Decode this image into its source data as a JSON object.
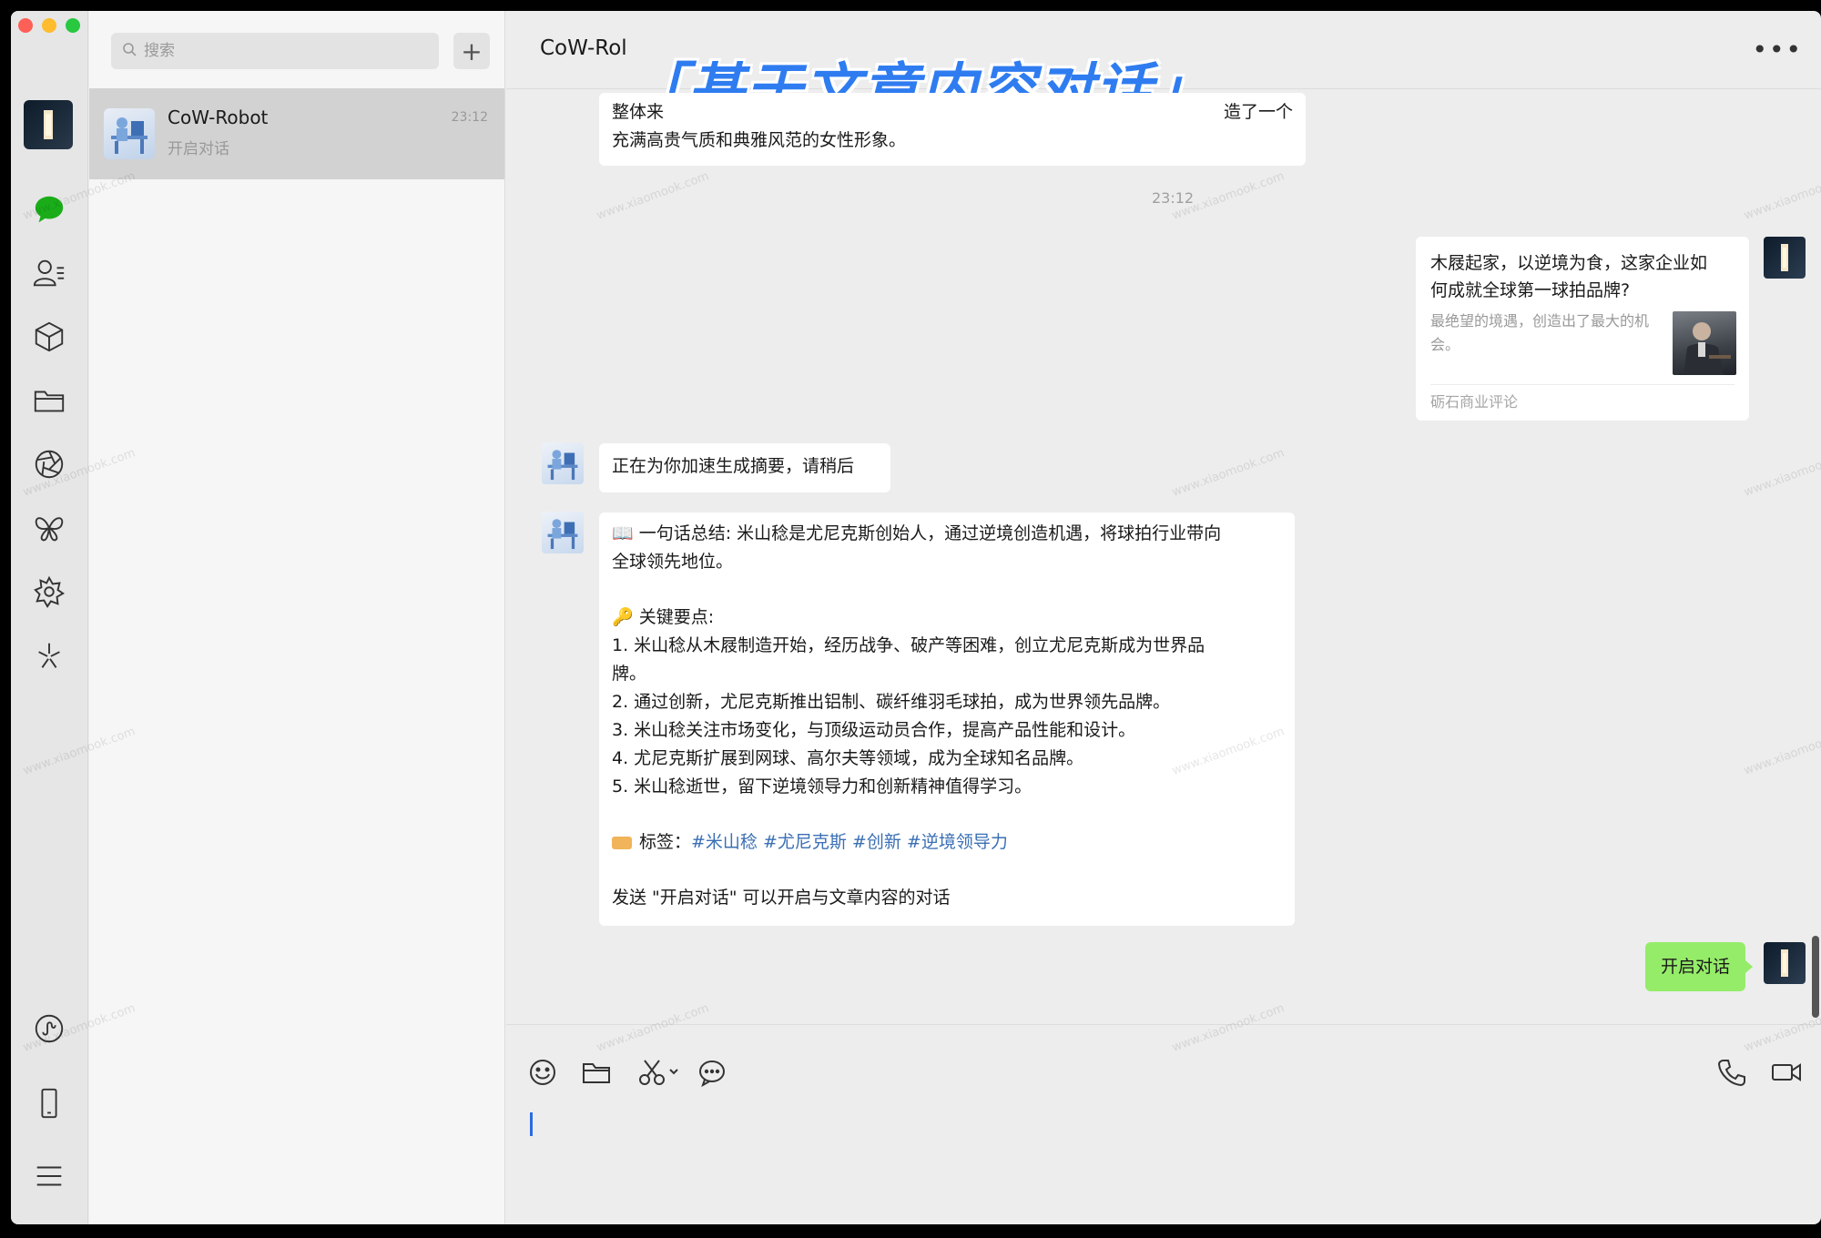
{
  "window": {
    "traffic_lights": {
      "close": "#fe5f57",
      "minimize": "#febc2e",
      "maximize": "#28c840"
    }
  },
  "sidebar": {
    "icons": [
      "user-avatar",
      "chat-icon",
      "contacts-icon",
      "box-icon",
      "folder-icon",
      "aperture-icon",
      "butterfly-icon",
      "gear-flower-icon",
      "sparkle-icon",
      "mini-program-icon",
      "phone-icon",
      "menu-icon"
    ]
  },
  "chat_list": {
    "search_placeholder": "搜索",
    "add_label": "+",
    "items": [
      {
        "name": "CoW-Robot",
        "time": "23:12",
        "preview": "开启对话"
      }
    ]
  },
  "chat": {
    "title": "CoW-Rol",
    "overlay_title": "「基于文章内容对话」",
    "more_label": "•••",
    "messages": {
      "top_partial_line1": "整体来",
      "top_partial_line1_end": "造了一个",
      "top_partial_line2": "充满高贵气质和典雅风范的女性形象。",
      "timestamp": "23:12",
      "card": {
        "title": "木屐起家，以逆境为食，这家企业如何成就全球第一球拍品牌?",
        "desc": "最绝望的境遇，创造出了最大的机会。",
        "source": "砺石商业评论"
      },
      "generating": "正在为你加速生成摘要，请稍后",
      "summary": {
        "line1": "📖 一句话总结: 米山稔是尤尼克斯创始人，通过逆境创造机遇，将球拍行业带向",
        "line2": "全球领先地位。",
        "keypoints_header": "🔑 关键要点:",
        "kp1a": "1. 米山稔从木屐制造开始，经历战争、破产等困难，创立尤尼克斯成为世界品",
        "kp1b": "牌。",
        "kp2": "2. 通过创新，尤尼克斯推出铝制、碳纤维羽毛球拍，成为世界领先品牌。",
        "kp3": "3. 米山稔关注市场变化，与顶级运动员合作，提高产品性能和设计。",
        "kp4": "4. 尤尼克斯扩展到网球、高尔夫等领域，成为全球知名品牌。",
        "kp5": "5. 米山稔逝世，留下逆境领导力和创新精神值得学习。",
        "tags_label": "标签：",
        "tags": "#米山稔 #尤尼克斯 #创新 #逆境领导力",
        "footer": "发送 \"开启对话\" 可以开启与文章内容的对话"
      },
      "sent": "开启对话"
    }
  },
  "composer": {
    "tools": [
      "emoji-icon",
      "folder-icon",
      "scissors-icon",
      "chat-bubble-icon"
    ],
    "right_tools": [
      "phone-call-icon",
      "video-call-icon"
    ]
  },
  "watermark_text": "www.xiaomook.com",
  "colors": {
    "accent_blue": "#2f7cf0",
    "sent_bubble": "#95ec69",
    "tag_link": "#3a6fb4"
  }
}
